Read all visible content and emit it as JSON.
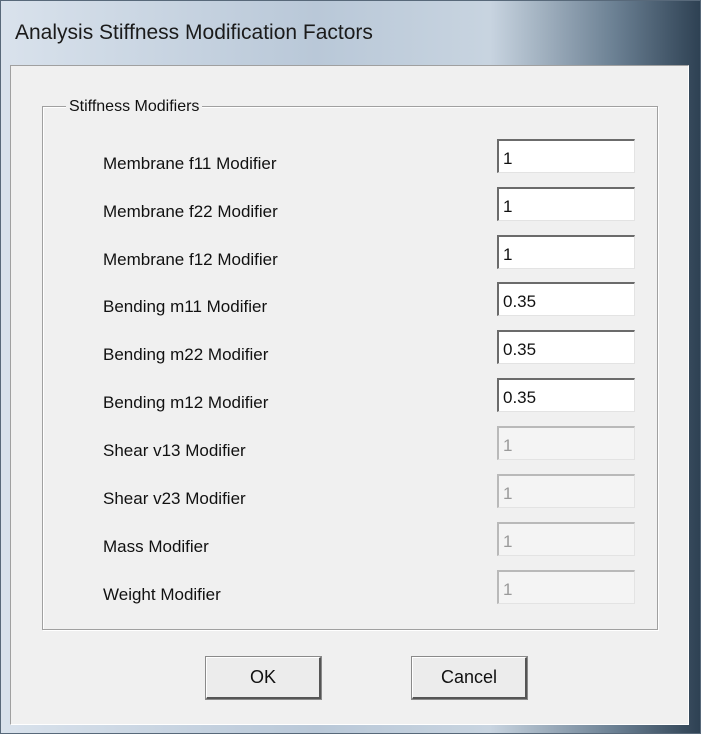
{
  "window": {
    "title": "Analysis Stiffness Modification Factors"
  },
  "group": {
    "label": "Stiffness Modifiers"
  },
  "rows": [
    {
      "label": "Membrane f11 Modifier",
      "value": "1",
      "enabled": true
    },
    {
      "label": "Membrane f22 Modifier",
      "value": "1",
      "enabled": true
    },
    {
      "label": "Membrane f12 Modifier",
      "value": "1",
      "enabled": true
    },
    {
      "label": "Bending  m11 Modifier",
      "value": "0.35",
      "enabled": true
    },
    {
      "label": "Bending  m22 Modifier",
      "value": "0.35",
      "enabled": true
    },
    {
      "label": "Bending  m12 Modifier",
      "value": "0.35",
      "enabled": true
    },
    {
      "label": "Shear  v13 Modifier",
      "value": "1",
      "enabled": false
    },
    {
      "label": "Shear  v23 Modifier",
      "value": "1",
      "enabled": false
    },
    {
      "label": "Mass Modifier",
      "value": "1",
      "enabled": false
    },
    {
      "label": "Weight Modifier",
      "value": "1",
      "enabled": false
    }
  ],
  "buttons": {
    "ok": "OK",
    "cancel": "Cancel"
  }
}
